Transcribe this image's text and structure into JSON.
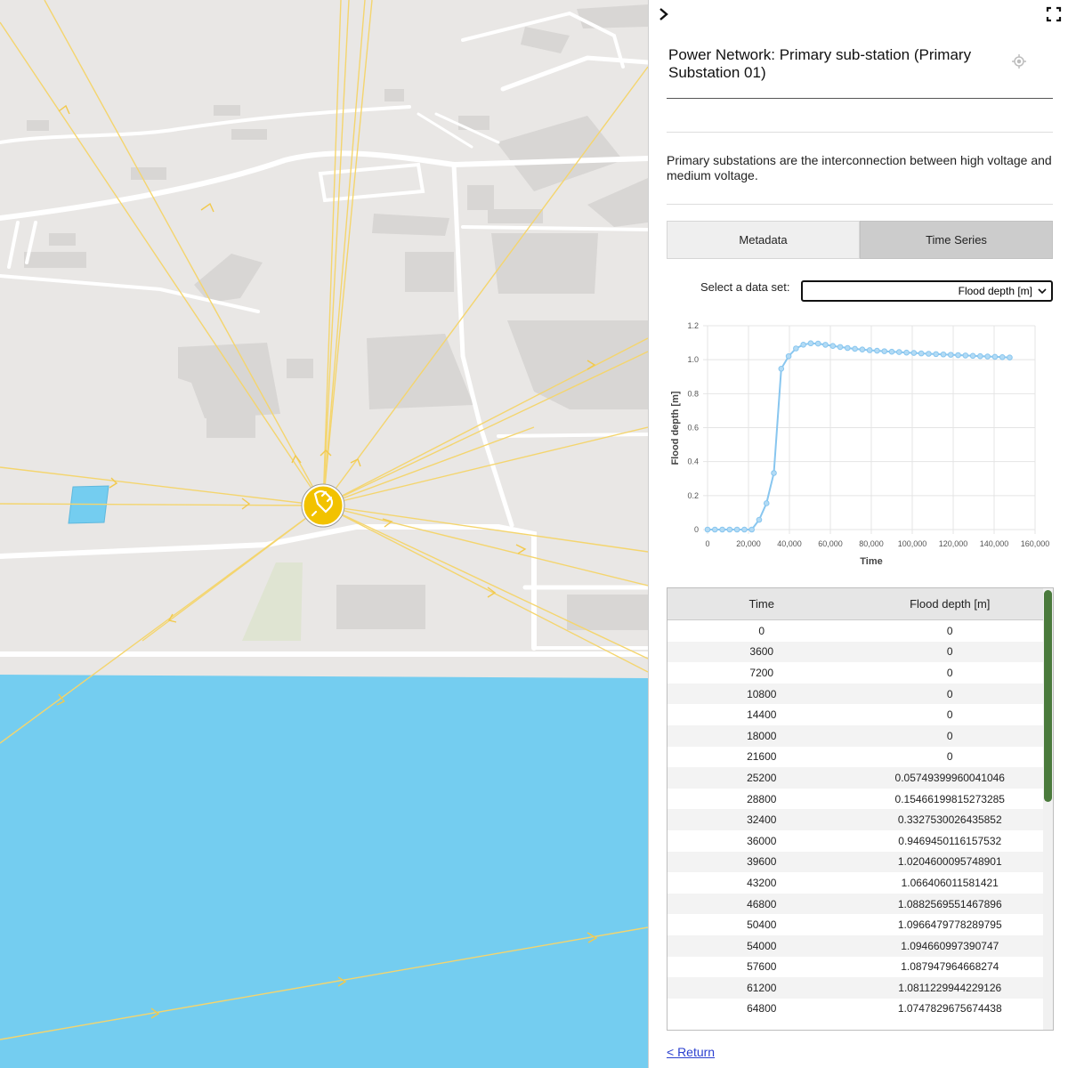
{
  "panel": {
    "title": "Power Network: Primary sub-station (Primary Substation 01)",
    "description": "Primary substations are the interconnection between high voltage and medium voltage.",
    "tabs": {
      "metadata": "Metadata",
      "time_series": "Time Series"
    },
    "dataset_label": "Select a data set:",
    "dataset_selected": "Flood depth [m]",
    "return_link": "< Return"
  },
  "map": {
    "colors": {
      "water": "#74cdf0",
      "land": "#e9e7e5",
      "building": "#d8d6d4",
      "road": "#ffffff",
      "power_line": "#f4d56e",
      "substation": "#f2c200"
    },
    "icons": [
      "substation-plug-icon"
    ]
  },
  "table": {
    "headers": [
      "Time",
      "Flood depth [m]"
    ],
    "rows": [
      [
        "0",
        "0"
      ],
      [
        "3600",
        "0"
      ],
      [
        "7200",
        "0"
      ],
      [
        "10800",
        "0"
      ],
      [
        "14400",
        "0"
      ],
      [
        "18000",
        "0"
      ],
      [
        "21600",
        "0"
      ],
      [
        "25200",
        "0.05749399960041046"
      ],
      [
        "28800",
        "0.15466199815273285"
      ],
      [
        "32400",
        "0.3327530026435852"
      ],
      [
        "36000",
        "0.9469450116157532"
      ],
      [
        "39600",
        "1.0204600095748901"
      ],
      [
        "43200",
        "1.066406011581421"
      ],
      [
        "46800",
        "1.0882569551467896"
      ],
      [
        "50400",
        "1.0966479778289795"
      ],
      [
        "54000",
        "1.094660997390747"
      ],
      [
        "57600",
        "1.087947964668274"
      ],
      [
        "61200",
        "1.0811229944229126"
      ],
      [
        "64800",
        "1.0747829675674438"
      ]
    ]
  },
  "chart_data": {
    "type": "line",
    "xlabel": "Time",
    "ylabel": "Flood depth [m]",
    "xlim": [
      0,
      160000
    ],
    "ylim": [
      0,
      1.2
    ],
    "xticks": [
      "0",
      "20,000",
      "40,000",
      "60,000",
      "80,000",
      "100,000",
      "120,000",
      "140,000",
      "160,000"
    ],
    "yticks": [
      "0",
      "0.2",
      "0.4",
      "0.6",
      "0.8",
      "1.0",
      "1.2"
    ],
    "grid": true,
    "series_color": "#88c6ef",
    "x": [
      0,
      3600,
      7200,
      10800,
      14400,
      18000,
      21600,
      25200,
      28800,
      32400,
      36000,
      39600,
      43200,
      46800,
      50400,
      54000,
      57600,
      61200,
      64800,
      68400,
      72000,
      75600,
      79200,
      82800,
      86400,
      90000,
      93600,
      97200,
      100800,
      104400,
      108000,
      111600,
      115200,
      118800,
      122400,
      126000,
      129600,
      133200,
      136800,
      140400,
      144000,
      147600
    ],
    "values": [
      0,
      0,
      0,
      0,
      0,
      0,
      0,
      0.0575,
      0.1547,
      0.3328,
      0.9469,
      1.0205,
      1.0664,
      1.0883,
      1.0966,
      1.0947,
      1.0879,
      1.0811,
      1.0748,
      1.069,
      1.064,
      1.06,
      1.056,
      1.053,
      1.05,
      1.047,
      1.045,
      1.042,
      1.04,
      1.037,
      1.035,
      1.033,
      1.031,
      1.029,
      1.027,
      1.025,
      1.023,
      1.021,
      1.019,
      1.017,
      1.015,
      1.013
    ]
  }
}
